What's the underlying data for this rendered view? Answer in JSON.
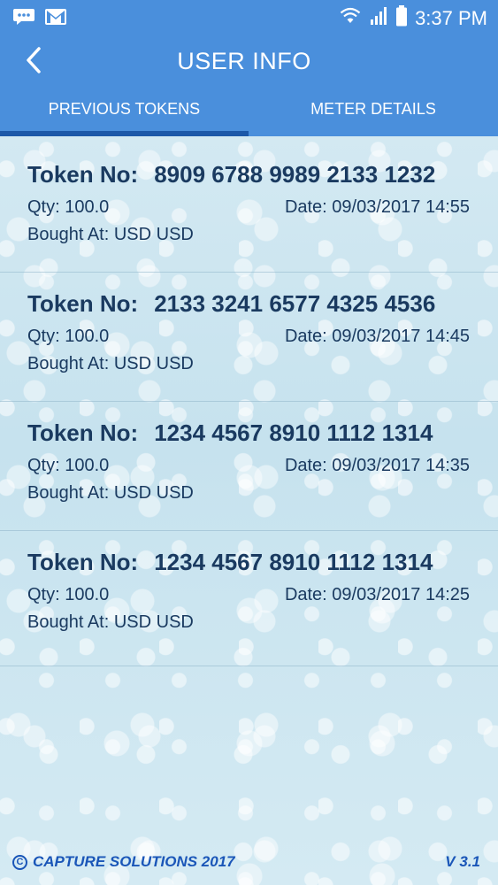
{
  "status_bar": {
    "time": "3:37 PM",
    "icons": [
      "message-icon",
      "gmail-icon",
      "wifi-icon",
      "signal-icon",
      "battery-icon"
    ]
  },
  "header": {
    "title": "USER INFO",
    "back_icon": "chevron-left-icon",
    "background_color": "#4a8fdc"
  },
  "tabs": [
    {
      "label": "PREVIOUS TOKENS",
      "active": true
    },
    {
      "label": "METER DETAILS",
      "active": false
    }
  ],
  "tokens": [
    {
      "label": "Token No:",
      "number": "8909 6788 9989 2133 1232",
      "qty": "Qty: 100.0",
      "date": "Date: 09/03/2017 14:55",
      "bought_at": "Bought At: USD USD"
    },
    {
      "label": "Token No:",
      "number": "2133 3241 6577 4325 4536",
      "qty": "Qty: 100.0",
      "date": "Date: 09/03/2017 14:45",
      "bought_at": "Bought At: USD USD"
    },
    {
      "label": "Token No:",
      "number": "1234 4567 8910 1112 1314",
      "qty": "Qty: 100.0",
      "date": "Date: 09/03/2017 14:35",
      "bought_at": "Bought At: USD USD"
    },
    {
      "label": "Token No:",
      "number": "1234 4567 8910 1112 1314",
      "qty": "Qty: 100.0",
      "date": "Date: 09/03/2017 14:25",
      "bought_at": "Bought At: USD USD"
    }
  ],
  "footer": {
    "copyright_symbol": "C",
    "copyright_text": "CAPTURE SOLUTIONS 2017",
    "version": "V 3.1"
  }
}
